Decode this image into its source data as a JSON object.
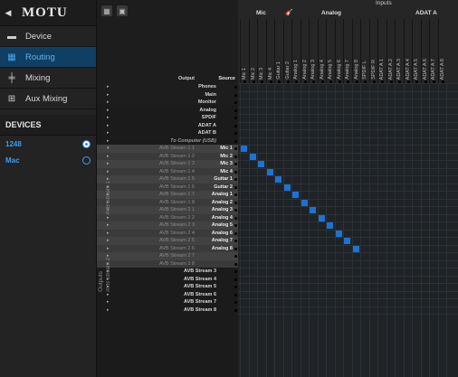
{
  "brand": {
    "back": "◀",
    "logo": "MOTU"
  },
  "nav": [
    {
      "label": "Device",
      "icon": "device-icon",
      "active": false
    },
    {
      "label": "Routing",
      "icon": "routing-grid-icon",
      "active": true
    },
    {
      "label": "Mixing",
      "icon": "faders-icon",
      "active": false
    },
    {
      "label": "Aux Mixing",
      "icon": "aux-faders-icon",
      "active": false
    }
  ],
  "devices_header": "DEVICES",
  "devices": [
    {
      "label": "1248",
      "selected": true
    },
    {
      "label": "Mac",
      "selected": false
    }
  ],
  "column_groups": {
    "inputs": "Inputs",
    "mic": "Mic",
    "analog": "Analog",
    "adat_a": "ADAT A"
  },
  "columns": [
    "Mic 1",
    "Mic 2",
    "Mic 3",
    "Mic 4",
    "Guitar 1",
    "Guitar 2",
    "Analog 1",
    "Analog 2",
    "Analog 3",
    "Analog 4",
    "Analog 5",
    "Analog 6",
    "Analog 7",
    "Analog 8",
    "SPDIF L",
    "SPDIF R",
    "ADAT A 1",
    "ADAT A 2",
    "ADAT A 3",
    "ADAT A 4",
    "ADAT A 5",
    "ADAT A 6",
    "ADAT A 7",
    "ADAT A 8"
  ],
  "output_header": "Output",
  "source_header": "Source",
  "side_labels": {
    "outputs": "Outputs",
    "avb1": "AVB Stream 1",
    "avb2": "AVB Stream 2"
  },
  "rows": [
    {
      "label": "Phones",
      "source": ""
    },
    {
      "label": "Main",
      "source": ""
    },
    {
      "label": "Monitor",
      "source": ""
    },
    {
      "label": "Analog",
      "source": ""
    },
    {
      "label": "SPDIF",
      "source": ""
    },
    {
      "label": "ADAT A",
      "source": ""
    },
    {
      "label": "ADAT B",
      "source": ""
    },
    {
      "label": "To Computer (USB)",
      "source": ""
    },
    {
      "label": "AVB Stream 1 1",
      "source": "Mic 1"
    },
    {
      "label": "AVB Stream 1 2",
      "source": "Mic 2"
    },
    {
      "label": "AVB Stream 1 3",
      "source": "Mic 3"
    },
    {
      "label": "AVB Stream 1 4",
      "source": "Mic 4"
    },
    {
      "label": "AVB Stream 1 5",
      "source": "Guitar 1"
    },
    {
      "label": "AVB Stream 1 6",
      "source": "Guitar 2"
    },
    {
      "label": "AVB Stream 1 7",
      "source": "Analog 1"
    },
    {
      "label": "AVB Stream 1 8",
      "source": "Analog 2"
    },
    {
      "label": "AVB Stream 2 1",
      "source": "Analog 3"
    },
    {
      "label": "AVB Stream 2 2",
      "source": "Analog 4"
    },
    {
      "label": "AVB Stream 2 3",
      "source": "Analog 5"
    },
    {
      "label": "AVB Stream 2 4",
      "source": "Analog 6"
    },
    {
      "label": "AVB Stream 2 5",
      "source": "Analog 7"
    },
    {
      "label": "AVB Stream 2 6",
      "source": "Analog 8"
    },
    {
      "label": "AVB Stream 2 7",
      "source": ""
    },
    {
      "label": "AVB Stream 2 8",
      "source": ""
    },
    {
      "label": "AVB Stream 3",
      "source": ""
    },
    {
      "label": "AVB Stream 4",
      "source": ""
    },
    {
      "label": "AVB Stream 5",
      "source": ""
    },
    {
      "label": "AVB Stream 6",
      "source": ""
    },
    {
      "label": "AVB Stream 7",
      "source": ""
    },
    {
      "label": "AVB Stream 8",
      "source": ""
    }
  ],
  "routes": [
    [
      8,
      0
    ],
    [
      9,
      1
    ],
    [
      10,
      2
    ],
    [
      11,
      3
    ],
    [
      12,
      4
    ],
    [
      13,
      5
    ],
    [
      14,
      6
    ],
    [
      15,
      7
    ],
    [
      16,
      8
    ],
    [
      17,
      9
    ],
    [
      18,
      10
    ],
    [
      19,
      11
    ],
    [
      20,
      12
    ],
    [
      21,
      13
    ]
  ],
  "colors": {
    "accent": "#1a73d6",
    "active_nav_bg": "#0f3f63"
  }
}
